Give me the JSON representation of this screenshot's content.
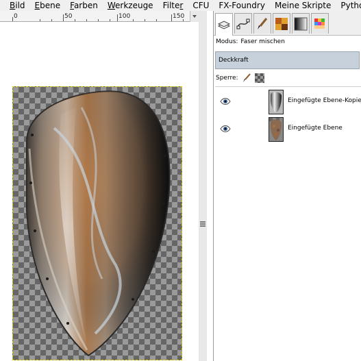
{
  "menubar": {
    "items": [
      {
        "label": "Bild",
        "mnemonic": "B",
        "rest": "ild"
      },
      {
        "label": "Ebene",
        "mnemonic": "E",
        "rest": "bene"
      },
      {
        "label": "Farben",
        "mnemonic": "F",
        "rest": "arben"
      },
      {
        "label": "Werkzeuge",
        "mnemonic": "W",
        "rest": "erkzeuge"
      },
      {
        "label": "Filter",
        "mnemonic": "",
        "rest": "Filte",
        "mnemonic_end": "r"
      },
      {
        "label": "CFU",
        "mnemonic": "",
        "rest": "CFU"
      },
      {
        "label": "FX-Foundry",
        "mnemonic": "",
        "rest": "FX-Foundry"
      },
      {
        "label": "Meine Skripte",
        "mnemonic": "",
        "rest": "Meine Skripte"
      },
      {
        "label": "Python-Fu",
        "mnemonic": "",
        "rest": "Python-Fu"
      }
    ]
  },
  "ruler": {
    "labels": [
      "0",
      "50",
      "100",
      "150"
    ]
  },
  "layers_dialog": {
    "tabs": [
      {
        "icon": "layers-icon",
        "active": true
      },
      {
        "icon": "paths-icon",
        "active": false
      },
      {
        "icon": "brush-icon",
        "active": false
      },
      {
        "icon": "pattern-icon",
        "active": false
      },
      {
        "icon": "gradient-icon",
        "active": false
      },
      {
        "icon": "palette-icon",
        "active": false
      }
    ],
    "mode_label": "Modus:",
    "mode_value": "Faser mischen",
    "opacity_label": "Deckkraft",
    "lock_label": "Sperre:",
    "layers": [
      {
        "name": "Eingefügte Ebene-Kopie",
        "visible": true,
        "thumb": "metal-gradient"
      },
      {
        "name": "Eingefügte Ebene",
        "visible": true,
        "thumb": "rust-texture"
      }
    ]
  },
  "colors": {
    "opacity_bar": "#c7d1dc",
    "selection_border": "#d8cc00"
  }
}
